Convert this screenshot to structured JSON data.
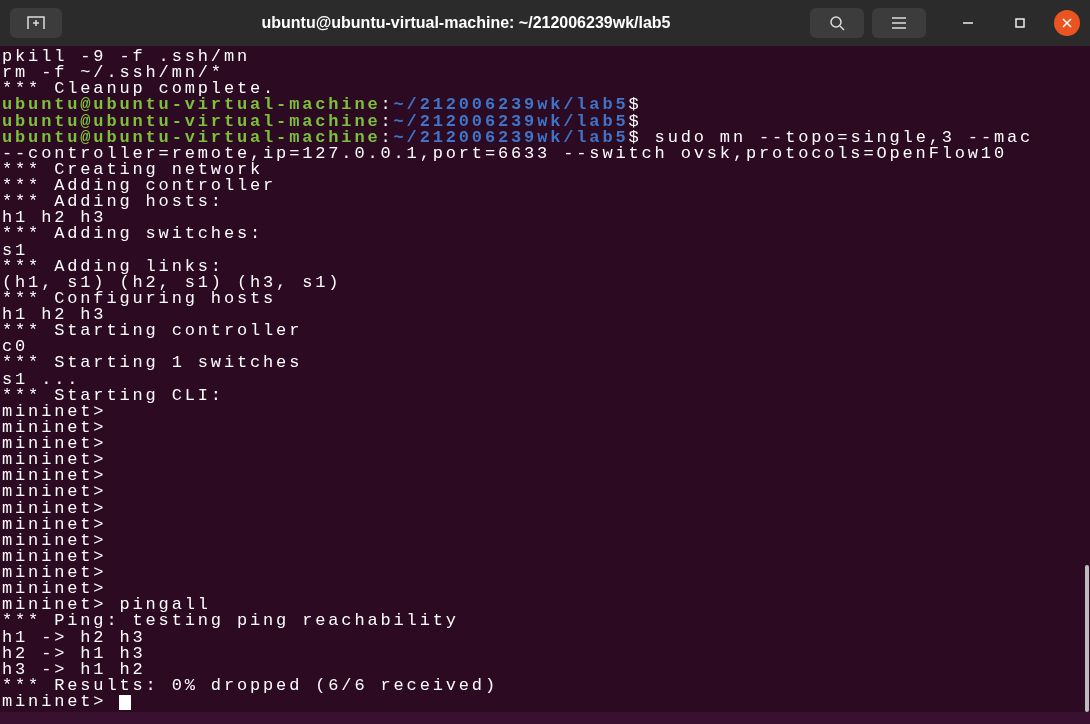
{
  "window": {
    "title": "ubuntu@ubuntu-virtual-machine: ~/212006239wk/lab5"
  },
  "terminal": {
    "lines": [
      {
        "kind": "output",
        "text": "pkill -9 -f .ssh/mn"
      },
      {
        "kind": "output",
        "text": "rm -f ~/.ssh/mn/*"
      },
      {
        "kind": "output",
        "text": "*** Cleanup complete."
      },
      {
        "kind": "prompt",
        "user": "ubuntu@ubuntu-virtual-machine",
        "separator": ":",
        "path": "~/212006239wk/lab5",
        "sign": "$"
      },
      {
        "kind": "prompt",
        "user": "ubuntu@ubuntu-virtual-machine",
        "separator": ":",
        "path": "~/212006239wk/lab5",
        "sign": "$"
      },
      {
        "kind": "prompt",
        "user": "ubuntu@ubuntu-virtual-machine",
        "separator": ":",
        "path": "~/212006239wk/lab5",
        "sign": "$",
        "command": "sudo mn --topo=single,3 --mac"
      },
      {
        "kind": "output",
        "text": "--controller=remote,ip=127.0.0.1,port=6633 --switch ovsk,protocols=OpenFlow10"
      },
      {
        "kind": "output",
        "text": "*** Creating network"
      },
      {
        "kind": "output",
        "text": "*** Adding controller"
      },
      {
        "kind": "output",
        "text": "*** Adding hosts:"
      },
      {
        "kind": "output",
        "text": "h1 h2 h3"
      },
      {
        "kind": "output",
        "text": "*** Adding switches:"
      },
      {
        "kind": "output",
        "text": "s1"
      },
      {
        "kind": "output",
        "text": "*** Adding links:"
      },
      {
        "kind": "output",
        "text": "(h1, s1) (h2, s1) (h3, s1)"
      },
      {
        "kind": "output",
        "text": "*** Configuring hosts"
      },
      {
        "kind": "output",
        "text": "h1 h2 h3"
      },
      {
        "kind": "output",
        "text": "*** Starting controller"
      },
      {
        "kind": "output",
        "text": "c0"
      },
      {
        "kind": "output",
        "text": "*** Starting 1 switches"
      },
      {
        "kind": "output",
        "text": "s1 ..."
      },
      {
        "kind": "output",
        "text": "*** Starting CLI:"
      },
      {
        "kind": "output",
        "text": "mininet>"
      },
      {
        "kind": "output",
        "text": "mininet>"
      },
      {
        "kind": "output",
        "text": "mininet>"
      },
      {
        "kind": "output",
        "text": "mininet>"
      },
      {
        "kind": "output",
        "text": "mininet>"
      },
      {
        "kind": "output",
        "text": "mininet>"
      },
      {
        "kind": "output",
        "text": "mininet>"
      },
      {
        "kind": "output",
        "text": "mininet>"
      },
      {
        "kind": "output",
        "text": "mininet>"
      },
      {
        "kind": "output",
        "text": "mininet>"
      },
      {
        "kind": "output",
        "text": "mininet>"
      },
      {
        "kind": "output",
        "text": "mininet>"
      },
      {
        "kind": "output",
        "text": "mininet> pingall"
      },
      {
        "kind": "output",
        "text": "*** Ping: testing ping reachability"
      },
      {
        "kind": "output",
        "text": "h1 -> h2 h3"
      },
      {
        "kind": "output",
        "text": "h2 -> h1 h3"
      },
      {
        "kind": "output",
        "text": "h3 -> h1 h2"
      },
      {
        "kind": "output",
        "text": "*** Results: 0% dropped (6/6 received)"
      },
      {
        "kind": "output",
        "text": "mininet> ",
        "cursor": true
      }
    ]
  }
}
